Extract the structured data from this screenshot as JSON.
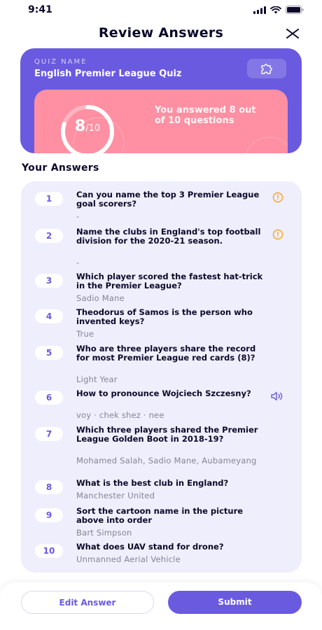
{
  "status_bar": {
    "time": "9:41",
    "icons": [
      "signal-icon",
      "wifi-icon",
      "battery-icon"
    ]
  },
  "header": {
    "title": "Review Answers",
    "close_icon": "close-icon"
  },
  "quiz": {
    "label": "QUIZ NAME",
    "name": "English Premier League Quiz",
    "icon": "puzzle-icon",
    "score": {
      "value": "8",
      "total": "/10",
      "fraction": 0.8,
      "message": "You answered 8 out of 10 questions"
    }
  },
  "answers_title": "Your Answers",
  "answers": [
    {
      "number": "1",
      "question": "Can you name the top 3 Premier League goal scorers?",
      "answer": "-",
      "icon": "warning-icon"
    },
    {
      "number": "2",
      "question": "Name the clubs in England's top football division for the 2020-21 season.",
      "answer": "-",
      "icon": "warning-icon"
    },
    {
      "number": "3",
      "question": "Which player scored the fastest hat-trick in the Premier League?",
      "answer": "Sadio Mane"
    },
    {
      "number": "4",
      "question": "Theodorus of Samos is the person who invented keys?",
      "answer": "True"
    },
    {
      "number": "5",
      "question": "Who are three players share the record for most Premier League red cards (8)?",
      "answer": "Light Year"
    },
    {
      "number": "6",
      "question": "How to pronounce Wojciech Szczesny?",
      "answer": "voy · chek shez · nee",
      "icon": "speaker-icon"
    },
    {
      "number": "7",
      "question": "Which three players shared the Premier League Golden Boot in 2018-19?",
      "answer": "Mohamed Salah, Sadio Mane, Aubameyang"
    },
    {
      "number": "8",
      "question": "What is the best club in England?",
      "answer": "Manchester United"
    },
    {
      "number": "9",
      "question": "Sort the cartoon name in the picture above into order",
      "answer": "Bart Simpson"
    },
    {
      "number": "10",
      "question": "What does UAV stand for drone?",
      "answer": "Unmanned Aerial Vehicle"
    }
  ],
  "buttons": {
    "edit": "Edit Answer",
    "submit": "Submit"
  },
  "colors": {
    "primary": "#6a5ae0",
    "score_card": "#ff8fa2",
    "panel": "#efeefc",
    "warning": "#f5a623"
  }
}
